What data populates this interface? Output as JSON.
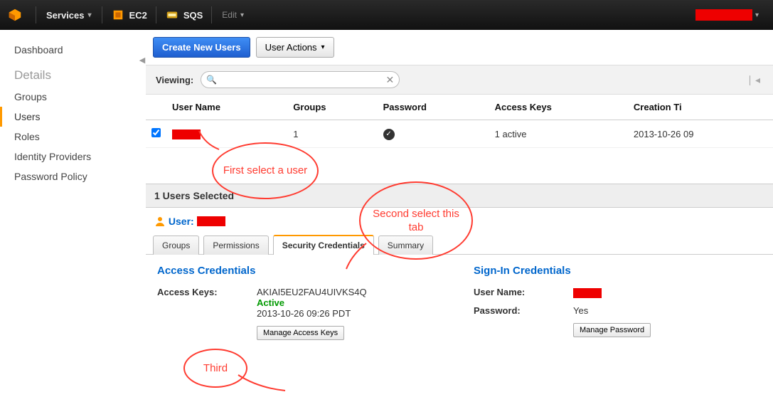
{
  "topbar": {
    "services_label": "Services",
    "svc1": "EC2",
    "svc2": "SQS",
    "edit_label": "Edit"
  },
  "sidebar": {
    "dashboard": "Dashboard",
    "heading": "Details",
    "items": [
      "Groups",
      "Users",
      "Roles",
      "Identity Providers",
      "Password Policy"
    ],
    "active_index": 1
  },
  "toolbar": {
    "create_label": "Create New Users",
    "actions_label": "User Actions"
  },
  "viewbar": {
    "label": "Viewing:",
    "search_value": "",
    "pager": "∣◂"
  },
  "table": {
    "headers": [
      "",
      "User Name",
      "Groups",
      "Password",
      "Access Keys",
      "Creation Ti"
    ],
    "rows": [
      {
        "checked": true,
        "username_redacted": true,
        "groups": "1",
        "password_has_check": true,
        "access_keys": "1 active",
        "creation": "2013-10-26 09"
      }
    ]
  },
  "detail": {
    "selected_label": "1 Users Selected",
    "user_label": "User:",
    "user_redacted": true,
    "tabs": [
      "Groups",
      "Permissions",
      "Security Credentials",
      "Summary"
    ],
    "active_tab_index": 2,
    "access_section_title": "Access Credentials",
    "access_keys_label": "Access Keys:",
    "access_key_id": "AKIAI5EU2FAU4UIVKS4Q",
    "access_key_status": "Active",
    "access_key_created": "2013-10-26 09:26 PDT",
    "manage_keys_btn": "Manage Access Keys",
    "signin_section_title": "Sign-In Credentials",
    "signin_user_label": "User Name:",
    "signin_user_redacted": true,
    "password_label": "Password:",
    "password_value": "Yes",
    "manage_password_btn": "Manage Password"
  },
  "annotations": {
    "first": "First select a user",
    "second": "Second select this tab",
    "third": "Third"
  }
}
